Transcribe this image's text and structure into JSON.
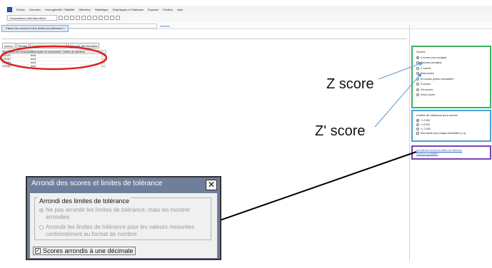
{
  "menubar": {
    "items": [
      "Fichier",
      "Données",
      "Homogénéité / Stabilité",
      "Sélection",
      "Statistique",
      "Graphiques et Tolérance",
      "Exporter",
      "Fenêtre",
      "Aide"
    ]
  },
  "toolbar": {
    "dropdown_value": "Comparaison interlaboratoire"
  },
  "addressbar": {
    "value": "Valeur non gérée",
    "link": "Annuler"
  },
  "document_tab": {
    "label": "Calcul des scores et des limites de tolérance 1"
  },
  "document_title": {
    "label": ""
  },
  "subtabs": [
    "Aperçu",
    "Scores",
    "Z calculé sur les données",
    "Résumé des données"
  ],
  "table": {
    "columns": [
      "Description de l'échantillon",
      "Description du mesurande / Limites de tolérance",
      ""
    ],
    "rows": [
      [
        "CODE1",
        "test1",
        "2,1"
      ],
      [
        "CODE2",
        "test1",
        "2,1"
      ],
      [
        "CODE3",
        "test1",
        "2,1"
      ],
      [
        "CODE4",
        "test1",
        "2,1"
      ]
    ]
  },
  "panel_scores": {
    "title": "Scores",
    "options": [
      {
        "label": "Z-scores (non corrigés)",
        "selected": true
      },
      {
        "label": "Z-scores (corrigés)",
        "selected": false
      },
      {
        "label": "Z'-scores",
        "selected": false
      },
      {
        "label": "Zeta-scores",
        "selected": false
      },
      {
        "label": "En-scores (erreur normalisée)",
        "selected": false
      },
      {
        "label": "D-scores",
        "selected": false
      },
      {
        "label": "D%-scores",
        "selected": false
      },
      {
        "label": "Zeta-D-score",
        "selected": false
      }
    ]
  },
  "panel_tolerance": {
    "title": "Limites de tolérance pour scores",
    "options": [
      {
        "label": "+/-2,000",
        "selected": true
      },
      {
        "label": "+/-3,000",
        "selected": false
      },
      {
        "label": "+/- 2,500",
        "selected": false
      }
    ],
    "checkbox": "Seuil limite pour chaque échantillon (1 σ)"
  },
  "panel_links": {
    "items": [
      "Arrondi des scores et limites de tolérance",
      "Nombres qualitatifs"
    ]
  },
  "annotations": {
    "z_score": "Z score",
    "z_prime_score": "Z' score"
  },
  "dialog": {
    "title": "Arrondi des scores et limites de tolérance",
    "close": "✕",
    "group_title": "Arrondi des limites de tolérance",
    "option1": "Ne pas arrondir les limites de tolérance, mais les montrer arrondies",
    "option2": "Arrondir les limites de tolérance pour les valeurs mesurées conformément au format de nombre",
    "checkbox_label": "Scores arrondis à une décimale",
    "checkbox_mark": "✓"
  },
  "colors": {
    "green_box": "#3fb15e",
    "blue_box": "#4aa0da",
    "purple_box": "#7c3fb3",
    "red_ellipse": "#e0201f",
    "dialog_titlebar": "#6f7f9b"
  }
}
